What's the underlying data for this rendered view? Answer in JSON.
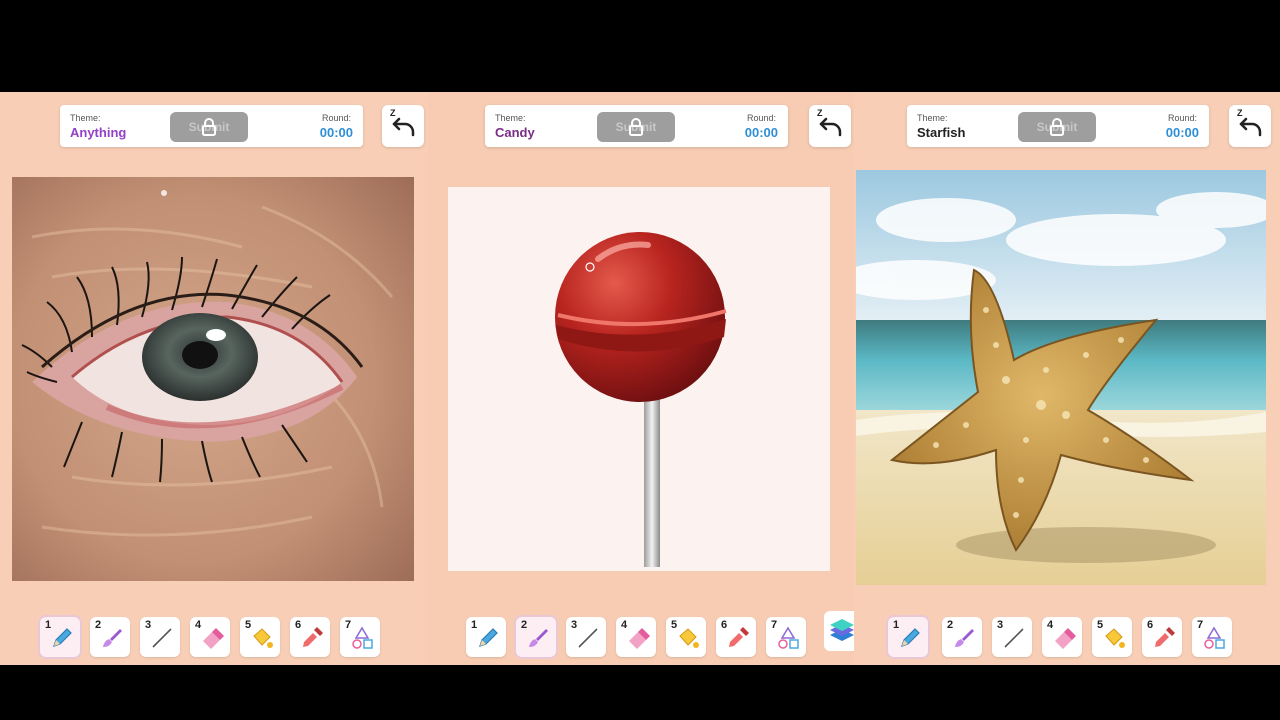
{
  "panels": [
    {
      "theme_label": "Theme:",
      "theme": "Anything",
      "theme_color": "#9440c9",
      "submit_label": "Submit",
      "round_label": "Round:",
      "round": "00:00",
      "undo_shortcut": "Z",
      "active_tool": 1
    },
    {
      "theme_label": "Theme:",
      "theme": "Candy",
      "theme_color": "#7a2c86",
      "submit_label": "Submit",
      "round_label": "Round:",
      "round": "00:00",
      "undo_shortcut": "Z",
      "active_tool": 2
    },
    {
      "theme_label": "Theme:",
      "theme": "Starfish",
      "theme_color": "#222222",
      "submit_label": "Submit",
      "round_label": "Round:",
      "round": "00:00",
      "undo_shortcut": "Z",
      "active_tool": 1
    }
  ],
  "tools": [
    {
      "num": "1",
      "icon": "pencil-icon"
    },
    {
      "num": "2",
      "icon": "brush-icon"
    },
    {
      "num": "3",
      "icon": "line-icon"
    },
    {
      "num": "4",
      "icon": "eraser-icon"
    },
    {
      "num": "5",
      "icon": "bucket-icon"
    },
    {
      "num": "6",
      "icon": "eyedropper-icon"
    },
    {
      "num": "7",
      "icon": "shapes-icon"
    }
  ],
  "colors": {
    "accent_blue": "#2f8fd6",
    "panel_bg": "#f8cfb6",
    "submit_disabled": "#9e9e9e"
  }
}
